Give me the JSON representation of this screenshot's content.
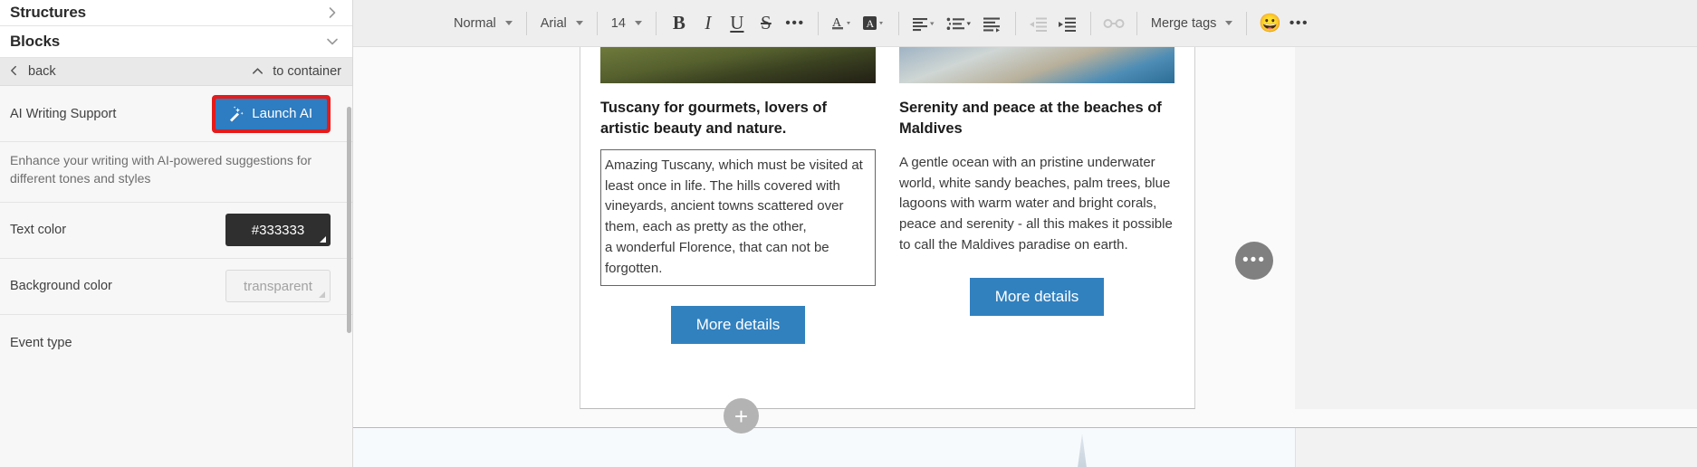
{
  "sidebar": {
    "sections": [
      {
        "title": "Structures",
        "icon": "chevron-right-icon"
      },
      {
        "title": "Blocks",
        "icon": "chevron-down-icon"
      }
    ],
    "back_bar": {
      "back_label": "back",
      "back_icon": "chevron-left-icon",
      "to_container_label": "to container",
      "to_container_icon": "chevron-up-icon"
    },
    "properties": [
      {
        "label": "AI Writing Support",
        "control": "button",
        "button_label": "Launch AI",
        "button_icon": "magic-wand-icon",
        "highlight_color": "#e51b1b",
        "button_color": "#2e7cc1"
      },
      {
        "label": "",
        "control": "help",
        "help_text": "Enhance your writing with AI-powered suggestions for different tones and styles"
      },
      {
        "label": "Text color",
        "control": "color-swatch",
        "value": "#333333",
        "swatch_style": "dark"
      },
      {
        "label": "Background color",
        "control": "color-swatch",
        "value": "transparent",
        "swatch_style": "light"
      },
      {
        "label": "Event type",
        "control": "none",
        "value": ""
      }
    ]
  },
  "toolbar": {
    "paragraph_style": "Normal",
    "font_family": "Arial",
    "font_size": "14",
    "bold": "B",
    "italic": "I",
    "underline": "U",
    "strikethrough": "S",
    "more_text_format": "•••",
    "font_color_icon": "font-color-icon",
    "highlight_color_icon": "highlight-color-icon",
    "align_icon": "align-left-icon",
    "list_icon": "bulleted-list-icon",
    "line_height_icon": "line-height-icon",
    "outdent_icon": "outdent-icon",
    "indent_icon": "indent-icon",
    "link_icon": "link-icon",
    "merge_tags_label": "Merge tags",
    "emoji_icon": "emoji-icon",
    "overflow_icon": "more-options-icon"
  },
  "canvas": {
    "columns": [
      {
        "image": "tuscany-vineyard-photo",
        "title": "Tuscany for gourmets, lovers of artistic beauty and nature.",
        "body": "Amazing Tuscany, which must be visited at least once in life. The hills covered with vineyards, ancient towns scattered over them, each as pretty as the other,\na wonderful Florence, that can not be forgotten.",
        "body_selected": true,
        "button_label": "More details"
      },
      {
        "image": "maldives-beach-photo",
        "title": "Serenity and peace at the beaches of Maldives",
        "body": "A gentle ocean with an pristine underwater world, white sandy beaches, palm trees, blue lagoons with warm water and bright corals, peace and serenity - all this makes it possible to call the Maldives paradise on earth.",
        "body_selected": false,
        "button_label": "More details"
      }
    ],
    "floating_more_label": "•••",
    "floating_add_label": "+",
    "button_color": "#3281bf"
  }
}
